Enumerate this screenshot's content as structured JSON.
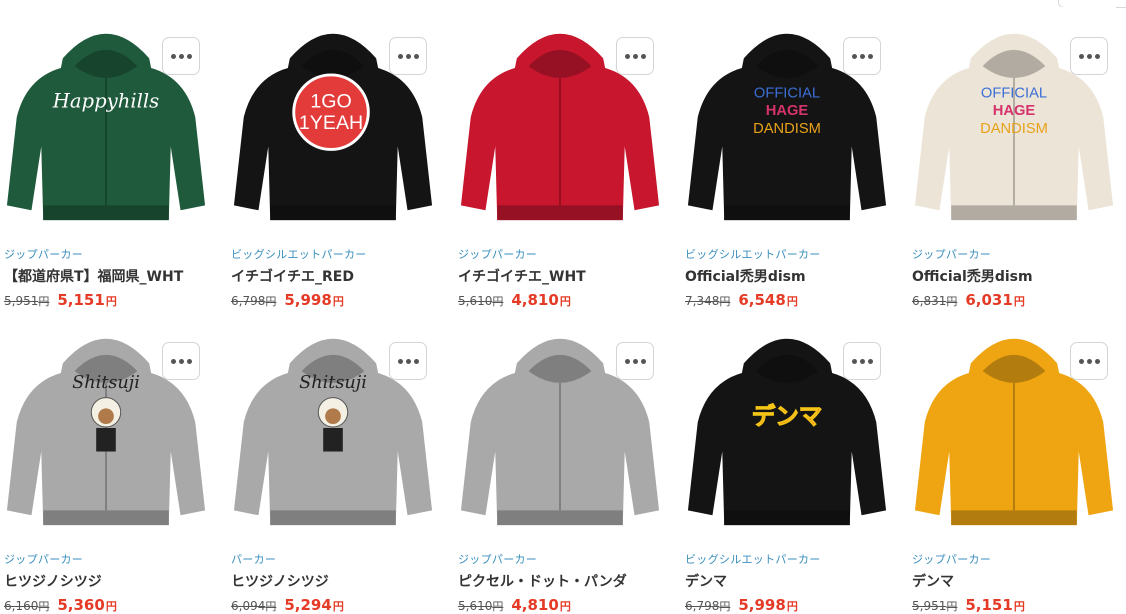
{
  "currency_suffix": "円",
  "products": [
    {
      "category": "ジップパーカー",
      "title": "【都道府県T】福岡県_WHT",
      "old_price": "5,951",
      "price": "5,151",
      "color": "#1f5a3c",
      "icon": "hoodie-icon",
      "print": "Happyhills"
    },
    {
      "category": "ビッグシルエットパーカー",
      "title": "イチゴイチエ_RED",
      "old_price": "6,798",
      "price": "5,998",
      "color": "#141414",
      "icon": "hoodie-icon",
      "print": "1GO 1YEAH"
    },
    {
      "category": "ジップパーカー",
      "title": "イチゴイチエ_WHT",
      "old_price": "5,610",
      "price": "4,810",
      "color": "#c8162e",
      "icon": "hoodie-icon",
      "print": ""
    },
    {
      "category": "ビッグシルエットパーカー",
      "title": "Official禿男dism",
      "old_price": "7,348",
      "price": "6,548",
      "color": "#141414",
      "icon": "hoodie-icon",
      "print": "OFFICIAL HAGE DANDISM"
    },
    {
      "category": "ジップパーカー",
      "title": "Official禿男dism",
      "old_price": "6,831",
      "price": "6,031",
      "color": "#ece4d6",
      "icon": "hoodie-icon",
      "print": "OFFICIAL HAGE DANDISM"
    },
    {
      "category": "ジップパーカー",
      "title": "ヒツジノシツジ",
      "old_price": "6,160",
      "price": "5,360",
      "color": "#a9a9a9",
      "icon": "hoodie-icon",
      "print": "Shitsuji"
    },
    {
      "category": "パーカー",
      "title": "ヒツジノシツジ",
      "old_price": "6,094",
      "price": "5,294",
      "color": "#a9a9a9",
      "icon": "hoodie-icon",
      "print": "Shitsuji"
    },
    {
      "category": "ジップパーカー",
      "title": "ピクセル・ドット・パンダ",
      "old_price": "5,610",
      "price": "4,810",
      "color": "#a9a9a9",
      "icon": "hoodie-icon",
      "print": ""
    },
    {
      "category": "ビッグシルエットパーカー",
      "title": "デンマ",
      "old_price": "6,798",
      "price": "5,998",
      "color": "#141414",
      "icon": "hoodie-icon",
      "print": "デンマ"
    },
    {
      "category": "ジップパーカー",
      "title": "デンマ",
      "old_price": "5,951",
      "price": "5,151",
      "color": "#efa512",
      "icon": "hoodie-icon",
      "print": ""
    }
  ]
}
